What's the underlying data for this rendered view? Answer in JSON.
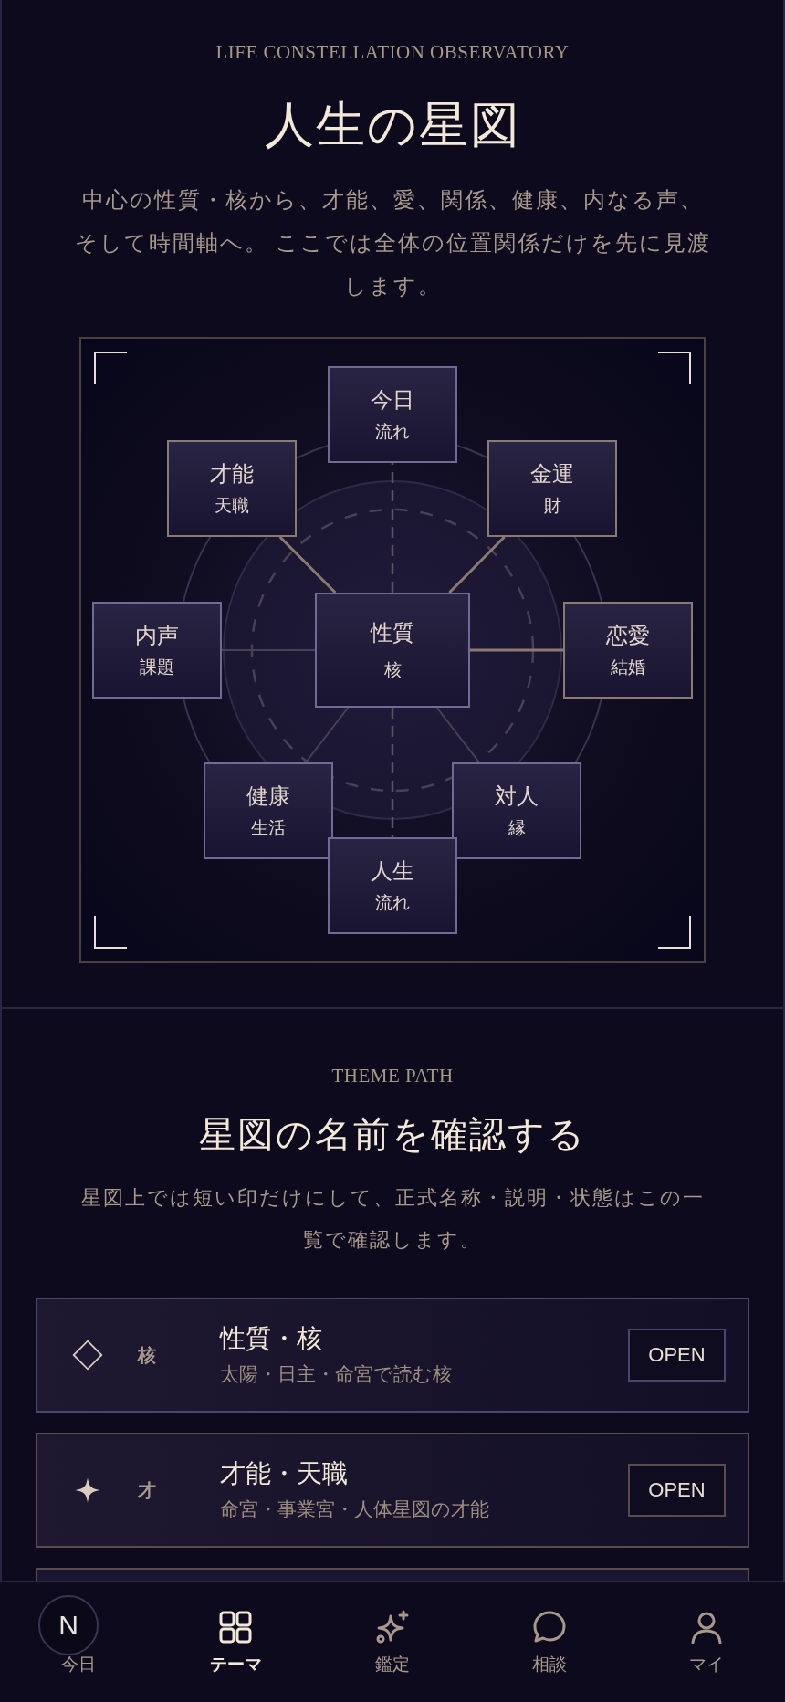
{
  "header": {
    "eyebrow": "LIFE CONSTELLATION OBSERVATORY",
    "title": "人生の星図",
    "description": "中心の性質・核から、才能、愛、関係、健康、内なる声、そして時間軸へ。 ここでは全体の位置関係だけを先に見渡します。"
  },
  "chart": {
    "nodes": [
      {
        "kind": "dashed",
        "title": "今日",
        "subtitle": "流れ",
        "color": "#6f6b94"
      },
      {
        "kind": "strong",
        "title": "才能",
        "subtitle": "天職",
        "color": "#8a7a72"
      },
      {
        "kind": "strong",
        "title": "金運",
        "subtitle": "財",
        "color": "#8a7a72"
      },
      {
        "kind": "faint",
        "title": "内声",
        "subtitle": "課題",
        "color": "#6f6b94"
      },
      {
        "kind": "core",
        "title": "性質",
        "subtitle": "核",
        "color": "#6f6b94"
      },
      {
        "kind": "strong",
        "title": "恋愛",
        "subtitle": "結婚",
        "color": "#8a7a72"
      },
      {
        "kind": "faint",
        "title": "健康",
        "subtitle": "生活",
        "color": "#6f6b94"
      },
      {
        "kind": "faint",
        "title": "対人",
        "subtitle": "縁",
        "color": "#6f6b94"
      },
      {
        "kind": "dashed",
        "title": "人生",
        "subtitle": "流れ",
        "color": "#6f6b94"
      }
    ]
  },
  "theme_path": {
    "eyebrow": "THEME PATH",
    "title": "星図の名前を確認する",
    "description": "星図上では短い印だけにして、正式名称・説明・状態はこの一覧で確認します。",
    "rows": [
      {
        "kind": "diamond",
        "mark": "核",
        "title": "性質・核",
        "subtitle": "太陽・日主・命宮で読む核",
        "button": "OPEN",
        "color": "#4a4670"
      },
      {
        "kind": "sparkle",
        "mark": "才",
        "title": "才能・天職",
        "subtitle": "命宮・事業宮・人体星図の才能",
        "button": "OPEN",
        "color": "#5a4c4c"
      }
    ]
  },
  "badge": {
    "letter": "N"
  },
  "nav": {
    "items": [
      {
        "label": "今日",
        "kind": "calendar",
        "selected": false
      },
      {
        "label": "テーマ",
        "kind": "grid",
        "selected": true
      },
      {
        "label": "鑑定",
        "kind": "sparkle",
        "selected": false
      },
      {
        "label": "相談",
        "kind": "chat",
        "selected": false
      },
      {
        "label": "マイ",
        "kind": "person",
        "selected": false
      }
    ]
  }
}
